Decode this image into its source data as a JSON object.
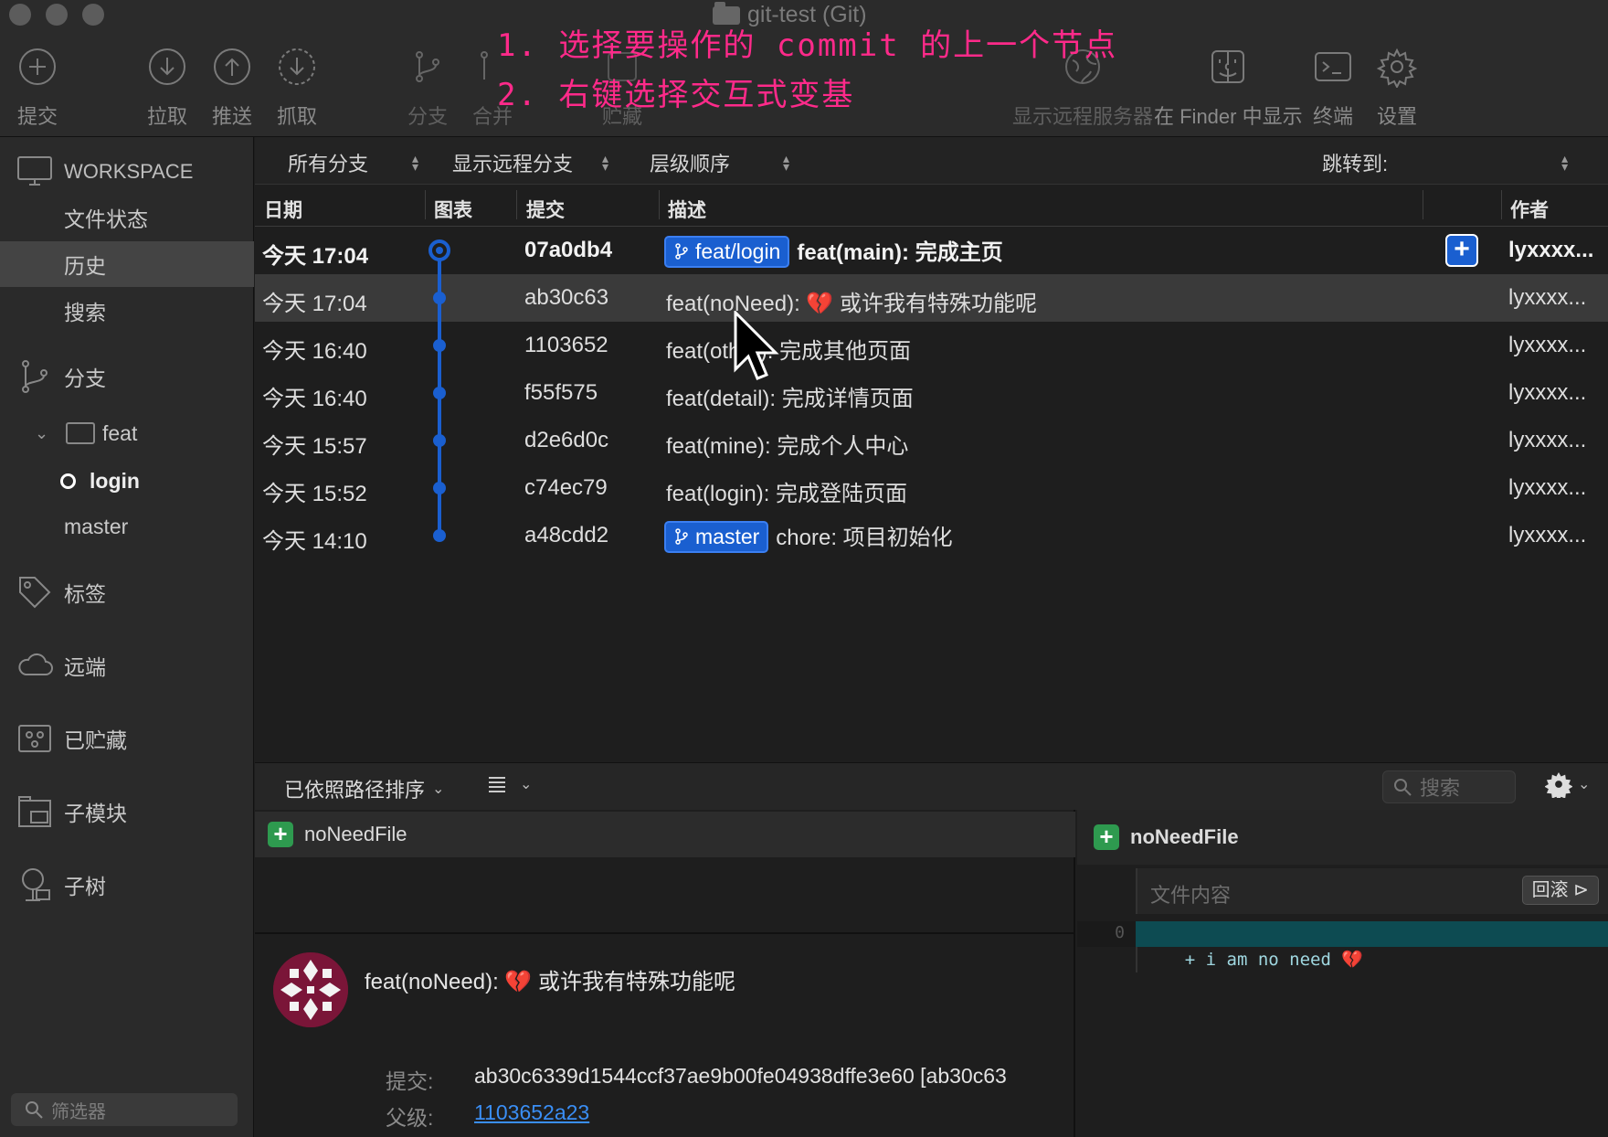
{
  "window": {
    "title": "git-test (Git)"
  },
  "toolbar": {
    "commit": "提交",
    "pull": "拉取",
    "push": "推送",
    "fetch": "抓取",
    "branch": "分支",
    "merge": "合并",
    "stash": "贮藏",
    "show_remote": "显示远程服务器",
    "show_in_finder": "在 Finder 中显示",
    "terminal": "终端",
    "settings": "设置"
  },
  "annotation": {
    "line1": "1. 选择要操作的 commit 的上一个节点",
    "line2": "2. 右键选择交互式变基"
  },
  "sidebar": {
    "workspace": "WORKSPACE",
    "file_status": "文件状态",
    "history": "历史",
    "search": "搜索",
    "branches": "分支",
    "folder_feat": "feat",
    "branch_login": "login",
    "branch_master": "master",
    "tags": "标签",
    "remotes": "远端",
    "stashes": "已贮藏",
    "submodules": "子模块",
    "subtrees": "子树",
    "filter_placeholder": "筛选器"
  },
  "filterbar": {
    "branches": "所有分支",
    "remote": "显示远程分支",
    "order": "层级顺序",
    "jump_to": "跳转到:"
  },
  "columns": {
    "date": "日期",
    "graph": "图表",
    "commit": "提交",
    "description": "描述",
    "author": "作者"
  },
  "commits": [
    {
      "date": "今天 17:04",
      "hash": "07a0db4",
      "tag": "feat/login",
      "msg": "feat(main): 完成主页",
      "author": "lyxxxx..."
    },
    {
      "date": "今天 17:04",
      "hash": "ab30c63",
      "msg_prefix": "feat(noNeed): ",
      "emoji": "💔",
      "msg_suffix": " 或许我有特殊功能呢",
      "author": "lyxxxx..."
    },
    {
      "date": "今天 16:40",
      "hash": "1103652",
      "msg": "feat(other): 完成其他页面",
      "author": "lyxxxx..."
    },
    {
      "date": "今天 16:40",
      "hash": "f55f575",
      "msg": "feat(detail): 完成详情页面",
      "author": "lyxxxx..."
    },
    {
      "date": "今天 15:57",
      "hash": "d2e6d0c",
      "msg": "feat(mine): 完成个人中心",
      "author": "lyxxxx..."
    },
    {
      "date": "今天 15:52",
      "hash": "c74ec79",
      "msg": "feat(login): 完成登陆页面",
      "author": "lyxxxx..."
    },
    {
      "date": "今天 14:10",
      "hash": "a48cdd2",
      "tag": "master",
      "msg": "chore: 项目初始化",
      "author": "lyxxxx..."
    }
  ],
  "bottom": {
    "sort_label": "已依照路径排序",
    "search_placeholder": "搜索",
    "file_name": "noNeedFile",
    "detail_title_prefix": "feat(noNeed): ",
    "detail_emoji": "💔",
    "detail_title_suffix": " 或许我有特殊功能呢",
    "commit_label": "提交:",
    "commit_value": "ab30c6339d1544ccf37ae9b00fe04938dffe3e60 [ab30c63",
    "parent_label": "父级:",
    "parent_value": "1103652a23",
    "right_file_name": "noNeedFile",
    "file_content_label": "文件内容",
    "rollback_label": "回滚",
    "diff_line_no": "0",
    "diff_line_text": "+ i am no need ",
    "diff_emoji": "💔"
  },
  "colors": {
    "accent": "#1a5fd0",
    "graph": "#1a5fd0",
    "annotation": "#ff2a8a",
    "diff_bg": "#0d4b52"
  }
}
